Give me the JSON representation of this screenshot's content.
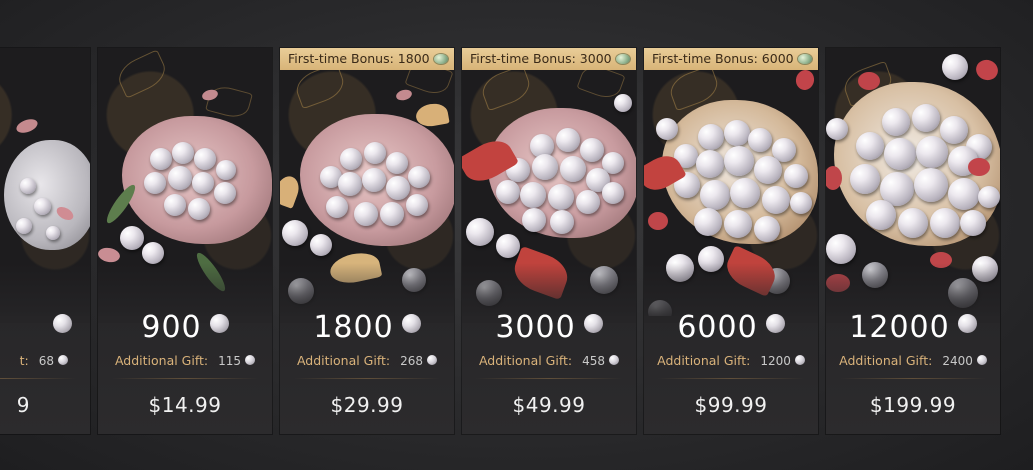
{
  "packages": [
    {
      "id": "partial",
      "amount": "",
      "gift_label": "",
      "gift_value": "68",
      "price": "9",
      "bonus": ""
    },
    {
      "id": "pack-900",
      "amount": "900",
      "gift_label": "Additional Gift:",
      "gift_value": "115",
      "price": "$14.99",
      "bonus": ""
    },
    {
      "id": "pack-1800",
      "amount": "1800",
      "gift_label": "Additional Gift:",
      "gift_value": "268",
      "price": "$29.99",
      "bonus": "First-time Bonus: 1800"
    },
    {
      "id": "pack-3000",
      "amount": "3000",
      "gift_label": "Additional Gift:",
      "gift_value": "458",
      "price": "$49.99",
      "bonus": "First-time Bonus: 3000"
    },
    {
      "id": "pack-6000",
      "amount": "6000",
      "gift_label": "Additional Gift:",
      "gift_value": "1200",
      "price": "$99.99",
      "bonus": "First-time Bonus: 6000"
    },
    {
      "id": "pack-12000",
      "amount": "12000",
      "gift_label": "Additional Gift:",
      "gift_value": "2400",
      "price": "$199.99",
      "bonus": ""
    }
  ],
  "colors": {
    "bonus_bg": "#e2c28a",
    "gift_label": "#d9b27a",
    "price_text": "#f1f1f1"
  },
  "icons": {
    "currency": "pearl-icon",
    "bonus": "jade-gem-icon"
  }
}
